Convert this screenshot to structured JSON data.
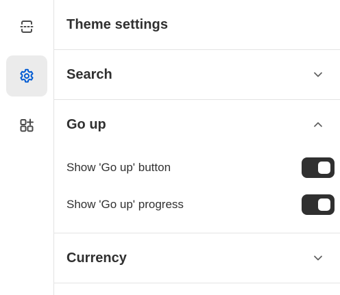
{
  "panel": {
    "title": "Theme settings"
  },
  "rail": {
    "items": [
      {
        "icon": "sections-icon",
        "active": false
      },
      {
        "icon": "gear-icon",
        "active": true
      },
      {
        "icon": "app-blocks-icon",
        "active": false
      }
    ]
  },
  "groups": {
    "search": {
      "title": "Search",
      "expanded": false
    },
    "go_up": {
      "title": "Go up",
      "expanded": true,
      "settings": [
        {
          "label": "Show 'Go up' button",
          "enabled": true
        },
        {
          "label": "Show 'Go up' progress",
          "enabled": true
        }
      ]
    },
    "currency": {
      "title": "Currency",
      "expanded": false
    }
  },
  "colors": {
    "accent": "#005bd3",
    "toggle_on": "#303030",
    "active_rail_bg": "#ebebeb",
    "divider": "#e3e3e3"
  }
}
